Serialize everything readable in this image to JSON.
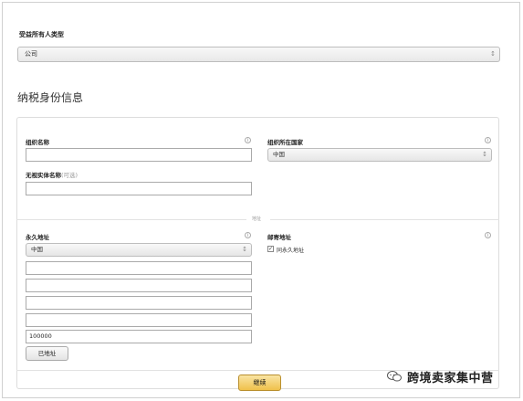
{
  "beneficiary_type": {
    "label": "受益所有人类型",
    "selected": "公司"
  },
  "section_title": "纳税身份信息",
  "tax_identity": {
    "org_name_label": "组织名称",
    "country_label": "组织所在国家",
    "country_selected": "中国",
    "disregarded_entity_label": "无视实体名称",
    "disregarded_entity_optional": "(可选)"
  },
  "divider_text": "地址",
  "permanent_address": {
    "label": "永久地址",
    "country_selected": "中国",
    "postal_code": "100000",
    "verify_button": "已地址"
  },
  "mailing_address": {
    "label": "邮寄地址",
    "same_as_permanent": "同永久地址"
  },
  "continue_button": "继续",
  "watermark": {
    "text": "跨境卖家集中营"
  }
}
